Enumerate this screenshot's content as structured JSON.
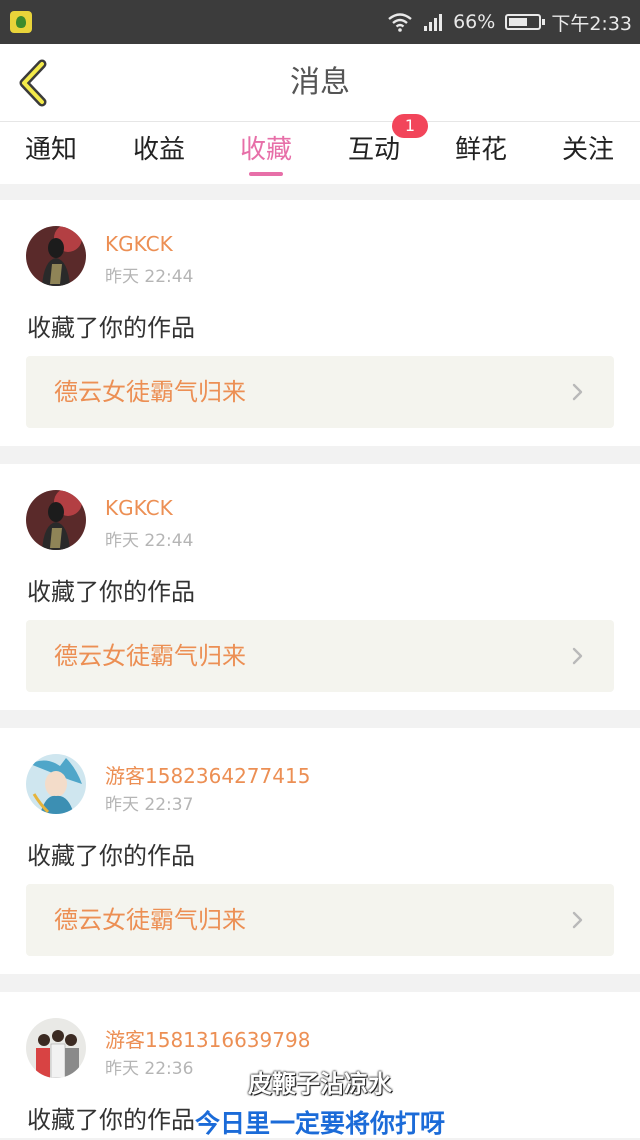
{
  "status_bar": {
    "battery": "66%",
    "time": "下午2:33",
    "battery_level": 0.66
  },
  "header": {
    "title": "消息",
    "back_icon": "chevron-left-icon"
  },
  "tabs": [
    {
      "label": "通知"
    },
    {
      "label": "收益"
    },
    {
      "label": "收藏"
    },
    {
      "label": "互动",
      "badge": "1"
    },
    {
      "label": "鲜花"
    },
    {
      "label": "关注"
    }
  ],
  "active_tab": "收藏",
  "messages": [
    {
      "username": "KGKCK",
      "time": "昨天 22:44",
      "action": "收藏了你的作品",
      "work": "德云女徒霸气归来"
    },
    {
      "username": "KGKCK",
      "time": "昨天 22:44",
      "action": "收藏了你的作品",
      "work": "德云女徒霸气归来"
    },
    {
      "username": "游客1582364277415",
      "time": "昨天 22:37",
      "action": "收藏了你的作品",
      "work": "德云女徒霸气归来"
    },
    {
      "username": "游客1581316639798",
      "time": "昨天 22:36",
      "action": "收藏了你的作品"
    }
  ],
  "subtitles": {
    "line1": "皮鞭子沾凉水",
    "line2": "今日里一定要将你打呀"
  },
  "colors": {
    "accent_pink": "#e76fa8",
    "username_orange": "#ec8f54",
    "badge_red": "#f2455a",
    "subtitle_blue": "#1b6bd8"
  }
}
